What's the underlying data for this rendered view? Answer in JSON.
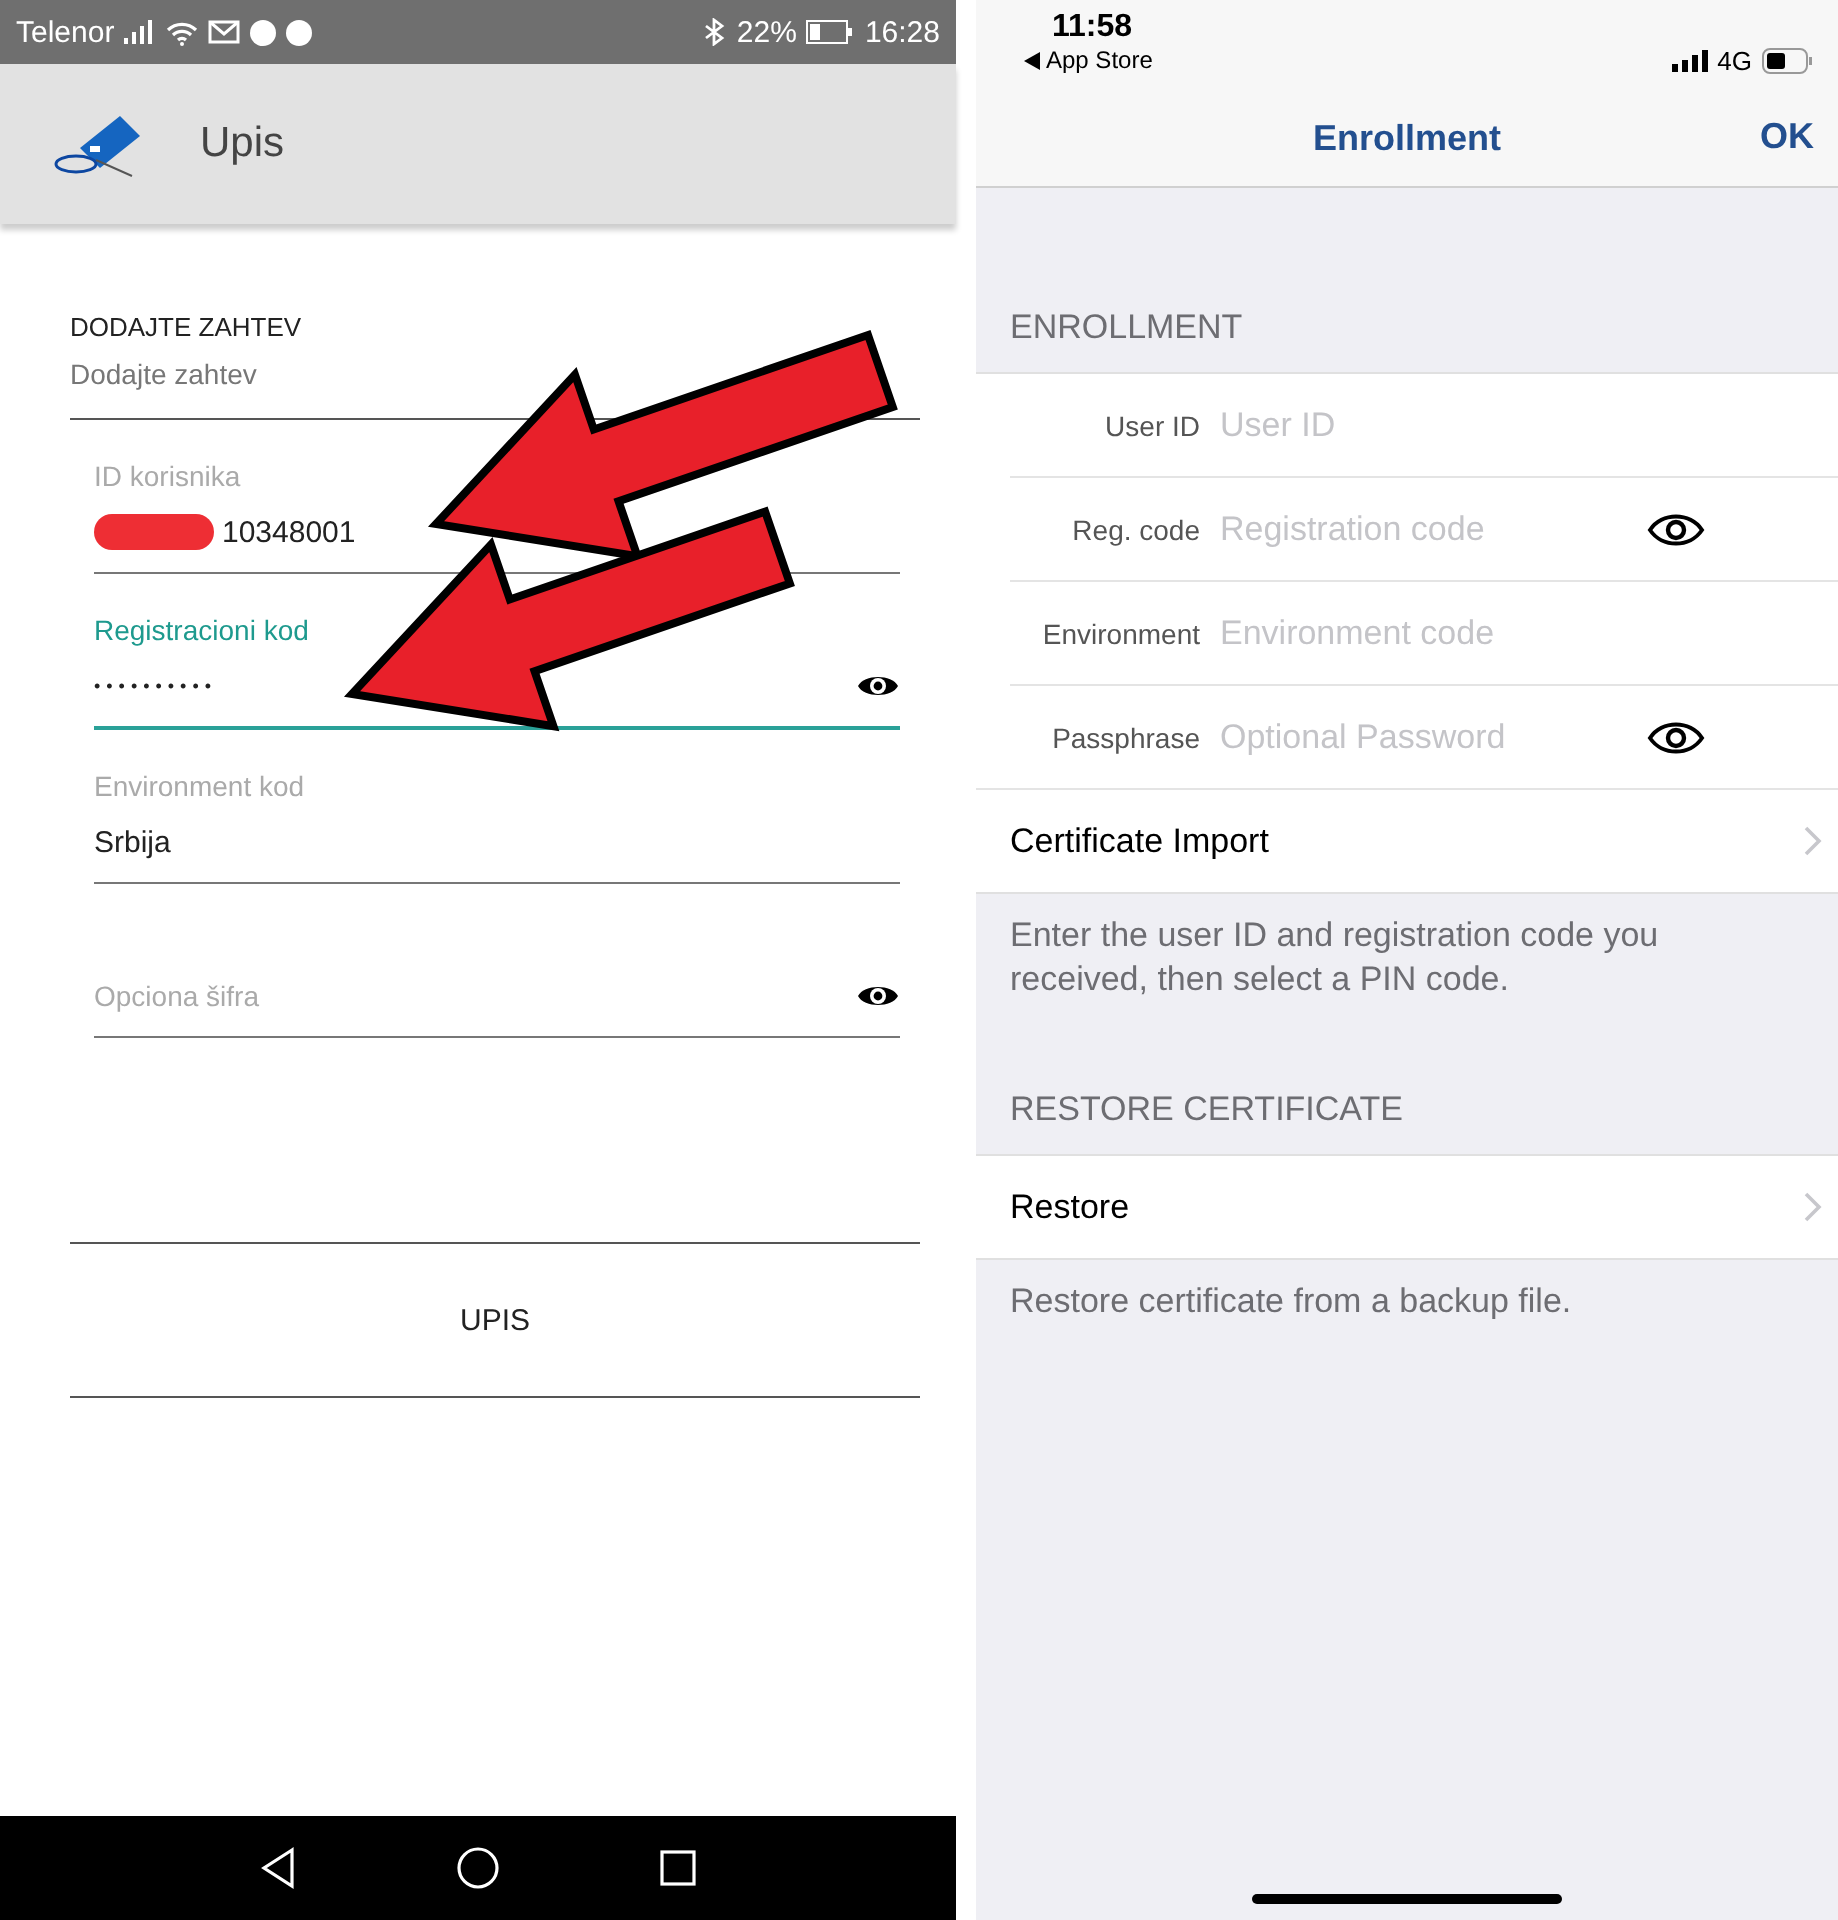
{
  "android": {
    "status_bar": {
      "carrier": "Telenor",
      "battery": "22%",
      "time": "16:28"
    },
    "app_bar": {
      "title": "Upis"
    },
    "section": {
      "title": "DODAJTE ZAHTEV",
      "placeholder": "Dodajte zahtev"
    },
    "fields": [
      {
        "label": "ID korisnika",
        "value": "10348001",
        "redacted": true,
        "focused": false,
        "password_toggle": false
      },
      {
        "label": "Registracioni kod",
        "value": "••••••••••",
        "redacted": false,
        "focused": true,
        "password_toggle": true
      },
      {
        "label": "Environment kod",
        "value": "Srbija",
        "redacted": false,
        "focused": false,
        "password_toggle": false
      },
      {
        "placeholder": "Opciona šifra",
        "redacted": false,
        "focused": false,
        "password_toggle": true
      }
    ],
    "button": "UPIS"
  },
  "ios": {
    "status_bar": {
      "time": "11:58",
      "back_app": "App Store",
      "network": "4G"
    },
    "nav": {
      "title": "Enrollment",
      "action": "OK"
    },
    "sections": [
      {
        "header": "ENROLLMENT",
        "rows": [
          {
            "kind": "field",
            "label": "User ID",
            "placeholder": "User ID",
            "reveal": false
          },
          {
            "kind": "field",
            "label": "Reg. code",
            "placeholder": "Registration code",
            "reveal": true
          },
          {
            "kind": "field",
            "label": "Environment",
            "placeholder": "Environment code",
            "reveal": false
          },
          {
            "kind": "field",
            "label": "Passphrase",
            "placeholder": "Optional Password",
            "reveal": true
          },
          {
            "kind": "link",
            "label": "Certificate Import"
          }
        ],
        "footer": "Enter the user ID and registration code you received, then select a PIN code."
      },
      {
        "header": "RESTORE CERTIFICATE",
        "rows": [
          {
            "kind": "link",
            "label": "Restore"
          }
        ],
        "footer": "Restore certificate from a backup file."
      }
    ]
  }
}
